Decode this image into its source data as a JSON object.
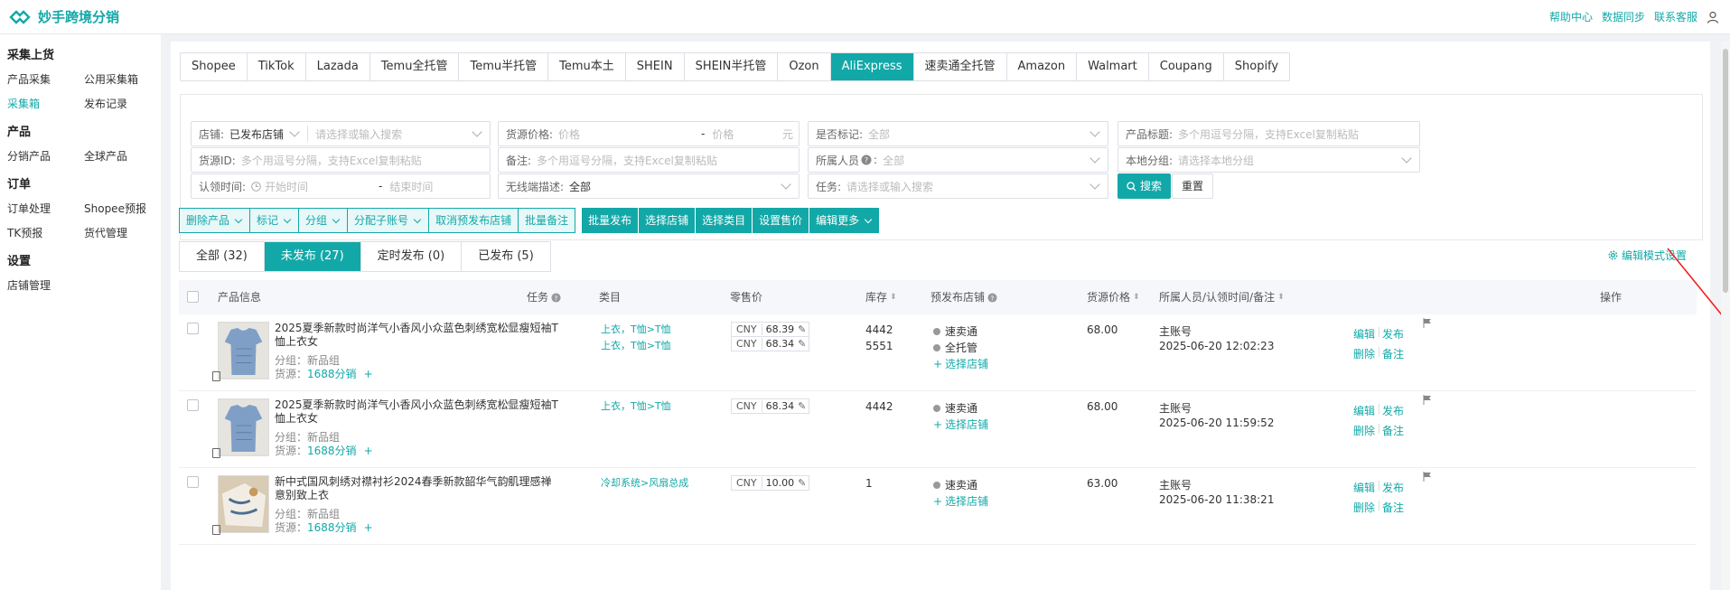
{
  "brand": {
    "name": "妙手跨境分销",
    "accent": "#13a8a8"
  },
  "top_links": [
    "帮助中心",
    "数据同步",
    "联系客服"
  ],
  "sidebar": {
    "sections": [
      {
        "title": "采集上货",
        "rows": [
          [
            "产品采集",
            "公用采集箱"
          ],
          [
            "采集箱",
            "发布记录"
          ]
        ]
      },
      {
        "title": "产品",
        "rows": [
          [
            "分销产品",
            "全球产品"
          ]
        ]
      },
      {
        "title": "订单",
        "rows": [
          [
            "订单处理",
            "Shopee预报"
          ],
          [
            "TK预报",
            "货代管理"
          ]
        ]
      },
      {
        "title": "设置",
        "rows": [
          [
            "店铺管理"
          ]
        ]
      }
    ],
    "active": "采集箱"
  },
  "platform_tabs": [
    "Shopee",
    "TikTok",
    "Lazada",
    "Temu全托管",
    "Temu半托管",
    "Temu本土",
    "SHEIN",
    "SHEIN半托管",
    "Ozon",
    "AliExpress",
    "速卖通全托管",
    "Amazon",
    "Walmart",
    "Coupang",
    "Shopify"
  ],
  "active_platform": "AliExpress",
  "filters": {
    "store_label": "店铺:",
    "store_value": "已发布店铺",
    "store_search_ph": "请选择或输入搜索",
    "price_label": "货源价格:",
    "price_min_ph": "价格",
    "price_sep": "-",
    "price_max_ph": "价格",
    "price_unit": "元",
    "marked_label": "是否标记:",
    "marked_value": "全部",
    "title_label": "产品标题:",
    "title_ph": "多个用逗号分隔，支持Excel复制粘贴",
    "sourceid_label": "货源ID:",
    "sourceid_ph": "多个用逗号分隔，支持Excel复制粘贴",
    "remark_label": "备注:",
    "remark_ph": "多个用逗号分隔，支持Excel复制粘贴",
    "owner_label": "所属人员",
    "owner_value": "全部",
    "group_label": "本地分组:",
    "group_ph": "请选择本地分组",
    "claim_label": "认领时间:",
    "claim_start_ph": "开始时间",
    "claim_sep": "-",
    "claim_end_ph": "结束时间",
    "wireless_label": "无线端描述:",
    "wireless_value": "全部",
    "task_label": "任务:",
    "task_ph": "请选择或输入搜索",
    "search_btn": "搜索",
    "reset_btn": "重置"
  },
  "action_bar": {
    "light": [
      "删除产品",
      "标记",
      "分组",
      "分配子账号",
      "取消预发布店铺",
      "批量备注"
    ],
    "light_dropdown": [
      true,
      true,
      true,
      true,
      false,
      false
    ],
    "dark": [
      "批量发布",
      "选择店铺",
      "选择类目",
      "设置售价",
      "编辑更多"
    ]
  },
  "status_tabs": [
    "全部 (32)",
    "未发布 (27)",
    "定时发布 (0)",
    "已发布 (5)"
  ],
  "active_status": 1,
  "edit_mode_label": "编辑模式设置",
  "table": {
    "headers": {
      "product": "产品信息",
      "task": "任务",
      "category": "类目",
      "price": "零售价",
      "stock": "库存",
      "stores": "预发布店铺",
      "source_price": "货源价格",
      "owner": "所属人员/认领时间/备注",
      "ops": "操作"
    },
    "rows": [
      {
        "title": "2025夏季新款时尚洋气小香风小众蓝色刺绣宽松显瘦短袖T恤上衣女",
        "group": "分组：新品组",
        "source_label": "货源：",
        "source": "1688分销",
        "categories": [
          "上衣，T恤>T恤",
          "上衣，T恤>T恤"
        ],
        "prices": [
          {
            "cur": "CNY",
            "val": "68.39"
          },
          {
            "cur": "CNY",
            "val": "68.34"
          }
        ],
        "stocks": [
          "4442",
          "5551"
        ],
        "stores": [
          "速卖通",
          "全托管"
        ],
        "select_store": "选择店铺",
        "source_price": "68.00",
        "owner": "主账号",
        "time": "2025-06-20 12:02:23",
        "ops": [
          "编辑",
          "发布",
          "删除",
          "备注"
        ]
      },
      {
        "title": "2025夏季新款时尚洋气小香风小众蓝色刺绣宽松显瘦短袖T恤上衣女",
        "group": "分组：新品组",
        "source_label": "货源：",
        "source": "1688分销",
        "categories": [
          "上衣，T恤>T恤"
        ],
        "prices": [
          {
            "cur": "CNY",
            "val": "68.34"
          }
        ],
        "stocks": [
          "4442"
        ],
        "stores": [
          "速卖通"
        ],
        "select_store": "选择店铺",
        "source_price": "68.00",
        "owner": "主账号",
        "time": "2025-06-20 11:59:52",
        "ops": [
          "编辑",
          "发布",
          "删除",
          "备注"
        ]
      },
      {
        "title": "新中式国风刺绣对襟衬衫2024春季新款韶华气韵肌理感禅意别致上衣",
        "group": "分组：新品组",
        "source_label": "货源：",
        "source": "1688分销",
        "categories": [
          "冷却系统>风扇总成"
        ],
        "prices": [
          {
            "cur": "CNY",
            "val": "10.00"
          }
        ],
        "stocks": [
          "1"
        ],
        "stores": [
          "速卖通"
        ],
        "select_store": "选择店铺",
        "source_price": "63.00",
        "owner": "主账号",
        "time": "2025-06-20 11:38:21",
        "ops": [
          "编辑",
          "发布",
          "删除",
          "备注"
        ]
      }
    ]
  }
}
